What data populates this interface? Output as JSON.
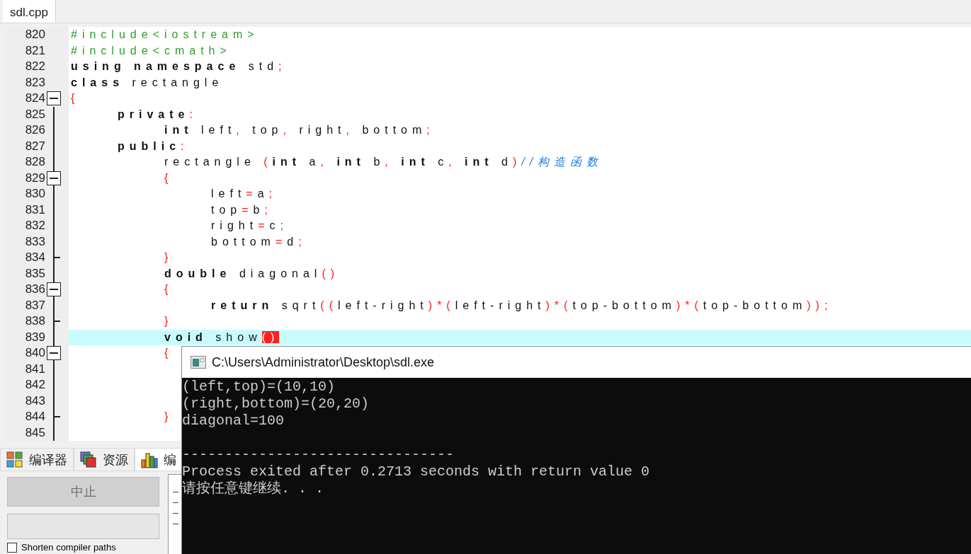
{
  "editor_tabs": [
    {
      "label": "sdl.cpp",
      "selected": true
    }
  ],
  "code": [
    {
      "number": "820",
      "fold_start": false,
      "fold_end": false,
      "current": false,
      "tokens": [
        {
          "kind": "preproc",
          "text": "#include<iostream>"
        }
      ]
    },
    {
      "number": "821",
      "fold_start": false,
      "fold_end": false,
      "current": false,
      "tokens": [
        {
          "kind": "preproc",
          "text": "#include<cmath>"
        }
      ]
    },
    {
      "number": "822",
      "fold_start": false,
      "fold_end": false,
      "current": false,
      "tokens": [
        {
          "kind": "keyword",
          "text": "using namespace"
        },
        {
          "kind": "plain",
          "text": " std"
        },
        {
          "kind": "punct",
          "text": ";"
        }
      ]
    },
    {
      "number": "823",
      "fold_start": false,
      "fold_end": false,
      "current": false,
      "tokens": [
        {
          "kind": "keyword",
          "text": "class"
        },
        {
          "kind": "plain",
          "text": " rectangle"
        }
      ]
    },
    {
      "number": "824",
      "fold_start": true,
      "fold_end": false,
      "current": false,
      "tokens": [
        {
          "kind": "punct",
          "text": "{"
        }
      ]
    },
    {
      "number": "825",
      "fold_start": false,
      "fold_end": false,
      "current": false,
      "tokens": [
        {
          "kind": "keyword",
          "text": "\tprivate"
        },
        {
          "kind": "punct",
          "text": ":"
        }
      ]
    },
    {
      "number": "826",
      "fold_start": false,
      "fold_end": false,
      "current": false,
      "tokens": [
        {
          "kind": "keyword",
          "text": "\t\tint"
        },
        {
          "kind": "plain",
          "text": " left"
        },
        {
          "kind": "punct",
          "text": ","
        },
        {
          "kind": "plain",
          "text": " top"
        },
        {
          "kind": "punct",
          "text": ","
        },
        {
          "kind": "plain",
          "text": " right"
        },
        {
          "kind": "punct",
          "text": ","
        },
        {
          "kind": "plain",
          "text": " bottom"
        },
        {
          "kind": "punct",
          "text": ";"
        }
      ]
    },
    {
      "number": "827",
      "fold_start": false,
      "fold_end": false,
      "current": false,
      "tokens": [
        {
          "kind": "keyword",
          "text": "\tpublic"
        },
        {
          "kind": "punct",
          "text": ":"
        }
      ]
    },
    {
      "number": "828",
      "fold_start": false,
      "fold_end": false,
      "current": false,
      "tokens": [
        {
          "kind": "plain",
          "text": "\t\trectangle "
        },
        {
          "kind": "punct",
          "text": "("
        },
        {
          "kind": "keyword",
          "text": "int"
        },
        {
          "kind": "plain",
          "text": " a"
        },
        {
          "kind": "punct",
          "text": ","
        },
        {
          "kind": "keyword",
          "text": " int"
        },
        {
          "kind": "plain",
          "text": " b"
        },
        {
          "kind": "punct",
          "text": ","
        },
        {
          "kind": "keyword",
          "text": " int"
        },
        {
          "kind": "plain",
          "text": " c"
        },
        {
          "kind": "punct",
          "text": ","
        },
        {
          "kind": "keyword",
          "text": " int"
        },
        {
          "kind": "plain",
          "text": " d"
        },
        {
          "kind": "punct",
          "text": ")"
        },
        {
          "kind": "comment",
          "text": "//构造函数"
        }
      ]
    },
    {
      "number": "829",
      "fold_start": true,
      "fold_end": false,
      "current": false,
      "tokens": [
        {
          "kind": "punct",
          "text": "\t\t{"
        }
      ]
    },
    {
      "number": "830",
      "fold_start": false,
      "fold_end": false,
      "current": false,
      "tokens": [
        {
          "kind": "plain",
          "text": "\t\t\tleft"
        },
        {
          "kind": "punct",
          "text": "="
        },
        {
          "kind": "plain",
          "text": "a"
        },
        {
          "kind": "punct",
          "text": ";"
        }
      ]
    },
    {
      "number": "831",
      "fold_start": false,
      "fold_end": false,
      "current": false,
      "tokens": [
        {
          "kind": "plain",
          "text": "\t\t\ttop"
        },
        {
          "kind": "punct",
          "text": "="
        },
        {
          "kind": "plain",
          "text": "b"
        },
        {
          "kind": "punct",
          "text": ";"
        }
      ]
    },
    {
      "number": "832",
      "fold_start": false,
      "fold_end": false,
      "current": false,
      "tokens": [
        {
          "kind": "plain",
          "text": "\t\t\tright"
        },
        {
          "kind": "punct",
          "text": "="
        },
        {
          "kind": "plain",
          "text": "c"
        },
        {
          "kind": "punct",
          "text": ";"
        }
      ]
    },
    {
      "number": "833",
      "fold_start": false,
      "fold_end": false,
      "current": false,
      "tokens": [
        {
          "kind": "plain",
          "text": "\t\t\tbottom"
        },
        {
          "kind": "punct",
          "text": "="
        },
        {
          "kind": "plain",
          "text": "d"
        },
        {
          "kind": "punct",
          "text": ";"
        }
      ]
    },
    {
      "number": "834",
      "fold_start": false,
      "fold_end": true,
      "current": false,
      "tokens": [
        {
          "kind": "punct",
          "text": "\t\t}"
        }
      ]
    },
    {
      "number": "835",
      "fold_start": false,
      "fold_end": false,
      "current": false,
      "tokens": [
        {
          "kind": "keyword",
          "text": "\t\tdouble"
        },
        {
          "kind": "plain",
          "text": " diagonal"
        },
        {
          "kind": "punct",
          "text": "()"
        }
      ]
    },
    {
      "number": "836",
      "fold_start": true,
      "fold_end": false,
      "current": false,
      "tokens": [
        {
          "kind": "punct",
          "text": "\t\t{"
        }
      ]
    },
    {
      "number": "837",
      "fold_start": false,
      "fold_end": false,
      "current": false,
      "tokens": [
        {
          "kind": "keyword",
          "text": "\t\t\treturn"
        },
        {
          "kind": "plain",
          "text": " sqrt"
        },
        {
          "kind": "punct",
          "text": "(("
        },
        {
          "kind": "plain",
          "text": "left-right"
        },
        {
          "kind": "punct",
          "text": ")*("
        },
        {
          "kind": "plain",
          "text": "left-right"
        },
        {
          "kind": "punct",
          "text": ")*("
        },
        {
          "kind": "plain",
          "text": "top-bottom"
        },
        {
          "kind": "punct",
          "text": ")*("
        },
        {
          "kind": "plain",
          "text": "top-bottom"
        },
        {
          "kind": "punct",
          "text": "));"
        }
      ]
    },
    {
      "number": "838",
      "fold_start": false,
      "fold_end": true,
      "current": false,
      "tokens": [
        {
          "kind": "punct",
          "text": "\t\t}"
        }
      ]
    },
    {
      "number": "839",
      "fold_start": false,
      "fold_end": false,
      "current": true,
      "tokens": [
        {
          "kind": "keyword",
          "text": "\t\tvoid"
        },
        {
          "kind": "plain",
          "text": " show"
        },
        {
          "kind": "match",
          "text": "()"
        }
      ]
    },
    {
      "number": "840",
      "fold_start": true,
      "fold_end": false,
      "current": false,
      "tokens": [
        {
          "kind": "punct",
          "text": "\t\t{"
        }
      ]
    },
    {
      "number": "841",
      "fold_start": false,
      "fold_end": false,
      "current": false
    },
    {
      "number": "842",
      "fold_start": false,
      "fold_end": false,
      "current": false
    },
    {
      "number": "843",
      "fold_start": false,
      "fold_end": false,
      "current": false
    },
    {
      "number": "844",
      "fold_start": false,
      "fold_end": true,
      "current": false,
      "tokens": [
        {
          "kind": "punct",
          "text": "\t\t}"
        }
      ]
    },
    {
      "number": "845",
      "fold_start": false,
      "fold_end": false,
      "current": false
    }
  ],
  "bottom_tabs": [
    {
      "label": "编译器",
      "selected": false
    },
    {
      "label": "资源",
      "selected": false
    },
    {
      "label": "编",
      "selected": true
    }
  ],
  "abort_button": {
    "label": "中止",
    "disabled": true
  },
  "shorten_paths": {
    "label": "Shorten compiler paths",
    "checked": false
  },
  "console": {
    "title": "C:\\Users\\Administrator\\Desktop\\sdl.exe",
    "lines": [
      {
        "kind": "output",
        "text": "(left,top)=(10,10)"
      },
      {
        "kind": "output",
        "text": "(right,bottom)=(20,20)"
      },
      {
        "kind": "output",
        "text": "diagonal=100"
      },
      {
        "kind": "separator",
        "text": "--------------------------------"
      },
      {
        "kind": "output",
        "text": "Process exited after 0.2713 seconds with return value 0"
      },
      {
        "kind": "output",
        "text": "请按任意键继续. . ."
      }
    ]
  }
}
